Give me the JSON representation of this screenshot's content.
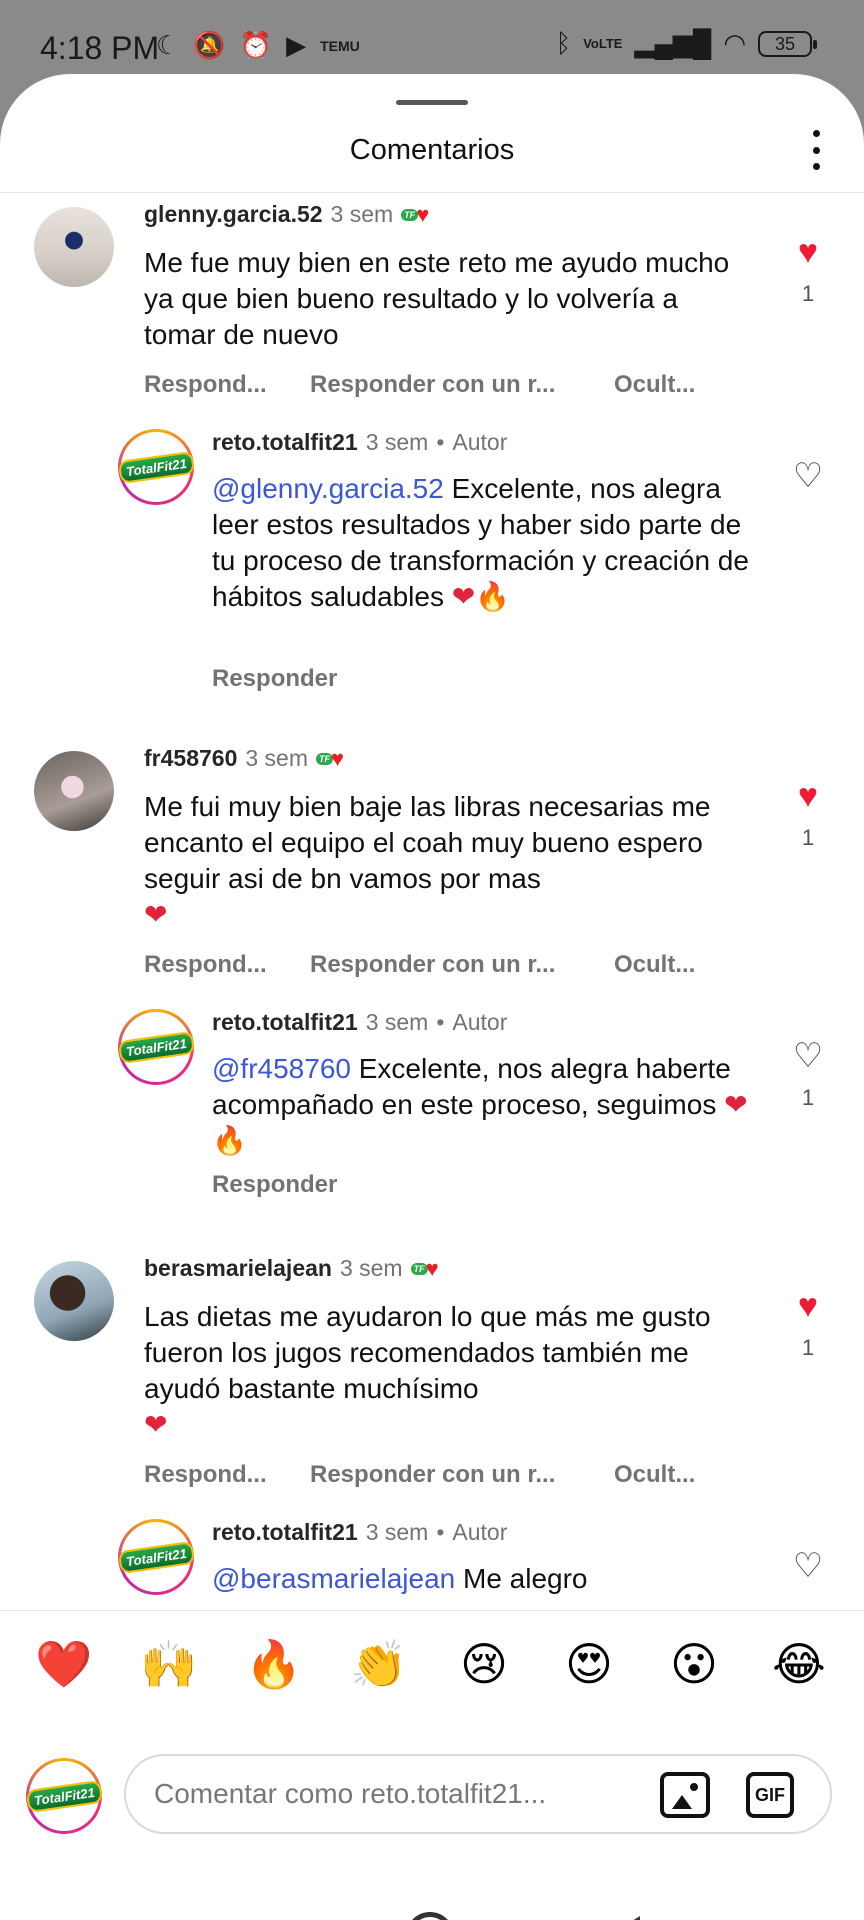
{
  "status_bar": {
    "time": "4:18 PM",
    "battery": "35",
    "network": "VoLTE"
  },
  "sheet": {
    "title": "Comentarios"
  },
  "comments": [
    {
      "user": "glenny.garcia.52",
      "time": "3 sem",
      "text": "Me fue muy bien en este  reto me ayudo mucho  ya que bien  bueno  resultado y lo volvería  a  tomar de nuevo",
      "likes": "1",
      "actions": [
        "Respond...",
        "Responder con un r...",
        "Ocult..."
      ]
    },
    {
      "user": "reto.totalfit21",
      "time": "3 sem",
      "author_tag": "Autor",
      "mention": "@glenny.garcia.52",
      "text": " Excelente, nos alegra leer estos resultados y haber sido parte de tu proceso de transformación y creación de hábitos saludables",
      "reply_label": "Responder"
    },
    {
      "user": "fr458760",
      "time": "3 sem",
      "text": "Me fui muy bien baje las libras necesarias me encanto el equipo el coah muy bueno espero seguir asi de bn vamos por mas",
      "likes": "1",
      "actions": [
        "Respond...",
        "Responder con un r...",
        "Ocult..."
      ]
    },
    {
      "user": "reto.totalfit21",
      "time": "3 sem",
      "author_tag": "Autor",
      "mention": "@fr458760",
      "text": " Excelente, nos alegra haberte acompañado en este proceso, seguimos",
      "likes": "1",
      "reply_label": "Responder"
    },
    {
      "user": "berasmarielajean",
      "time": "3 sem",
      "text": "Las dietas me ayudaron lo que más me gusto fueron los jugos recomendados también me ayudó bastante muchísimo",
      "likes": "1",
      "actions": [
        "Respond...",
        "Responder con un r...",
        "Ocult..."
      ]
    },
    {
      "user": "reto.totalfit21",
      "time": "3 sem",
      "author_tag": "Autor",
      "mention": "@berasmarielajean",
      "text": " Me alegro"
    }
  ],
  "meta_separator": "•",
  "quick_reactions": [
    "❤️",
    "🙌",
    "🔥",
    "👏",
    "😢",
    "😍",
    "😮",
    "😂"
  ],
  "composer": {
    "placeholder": "Comentar como reto.totalfit21...",
    "gif_label": "GIF"
  }
}
